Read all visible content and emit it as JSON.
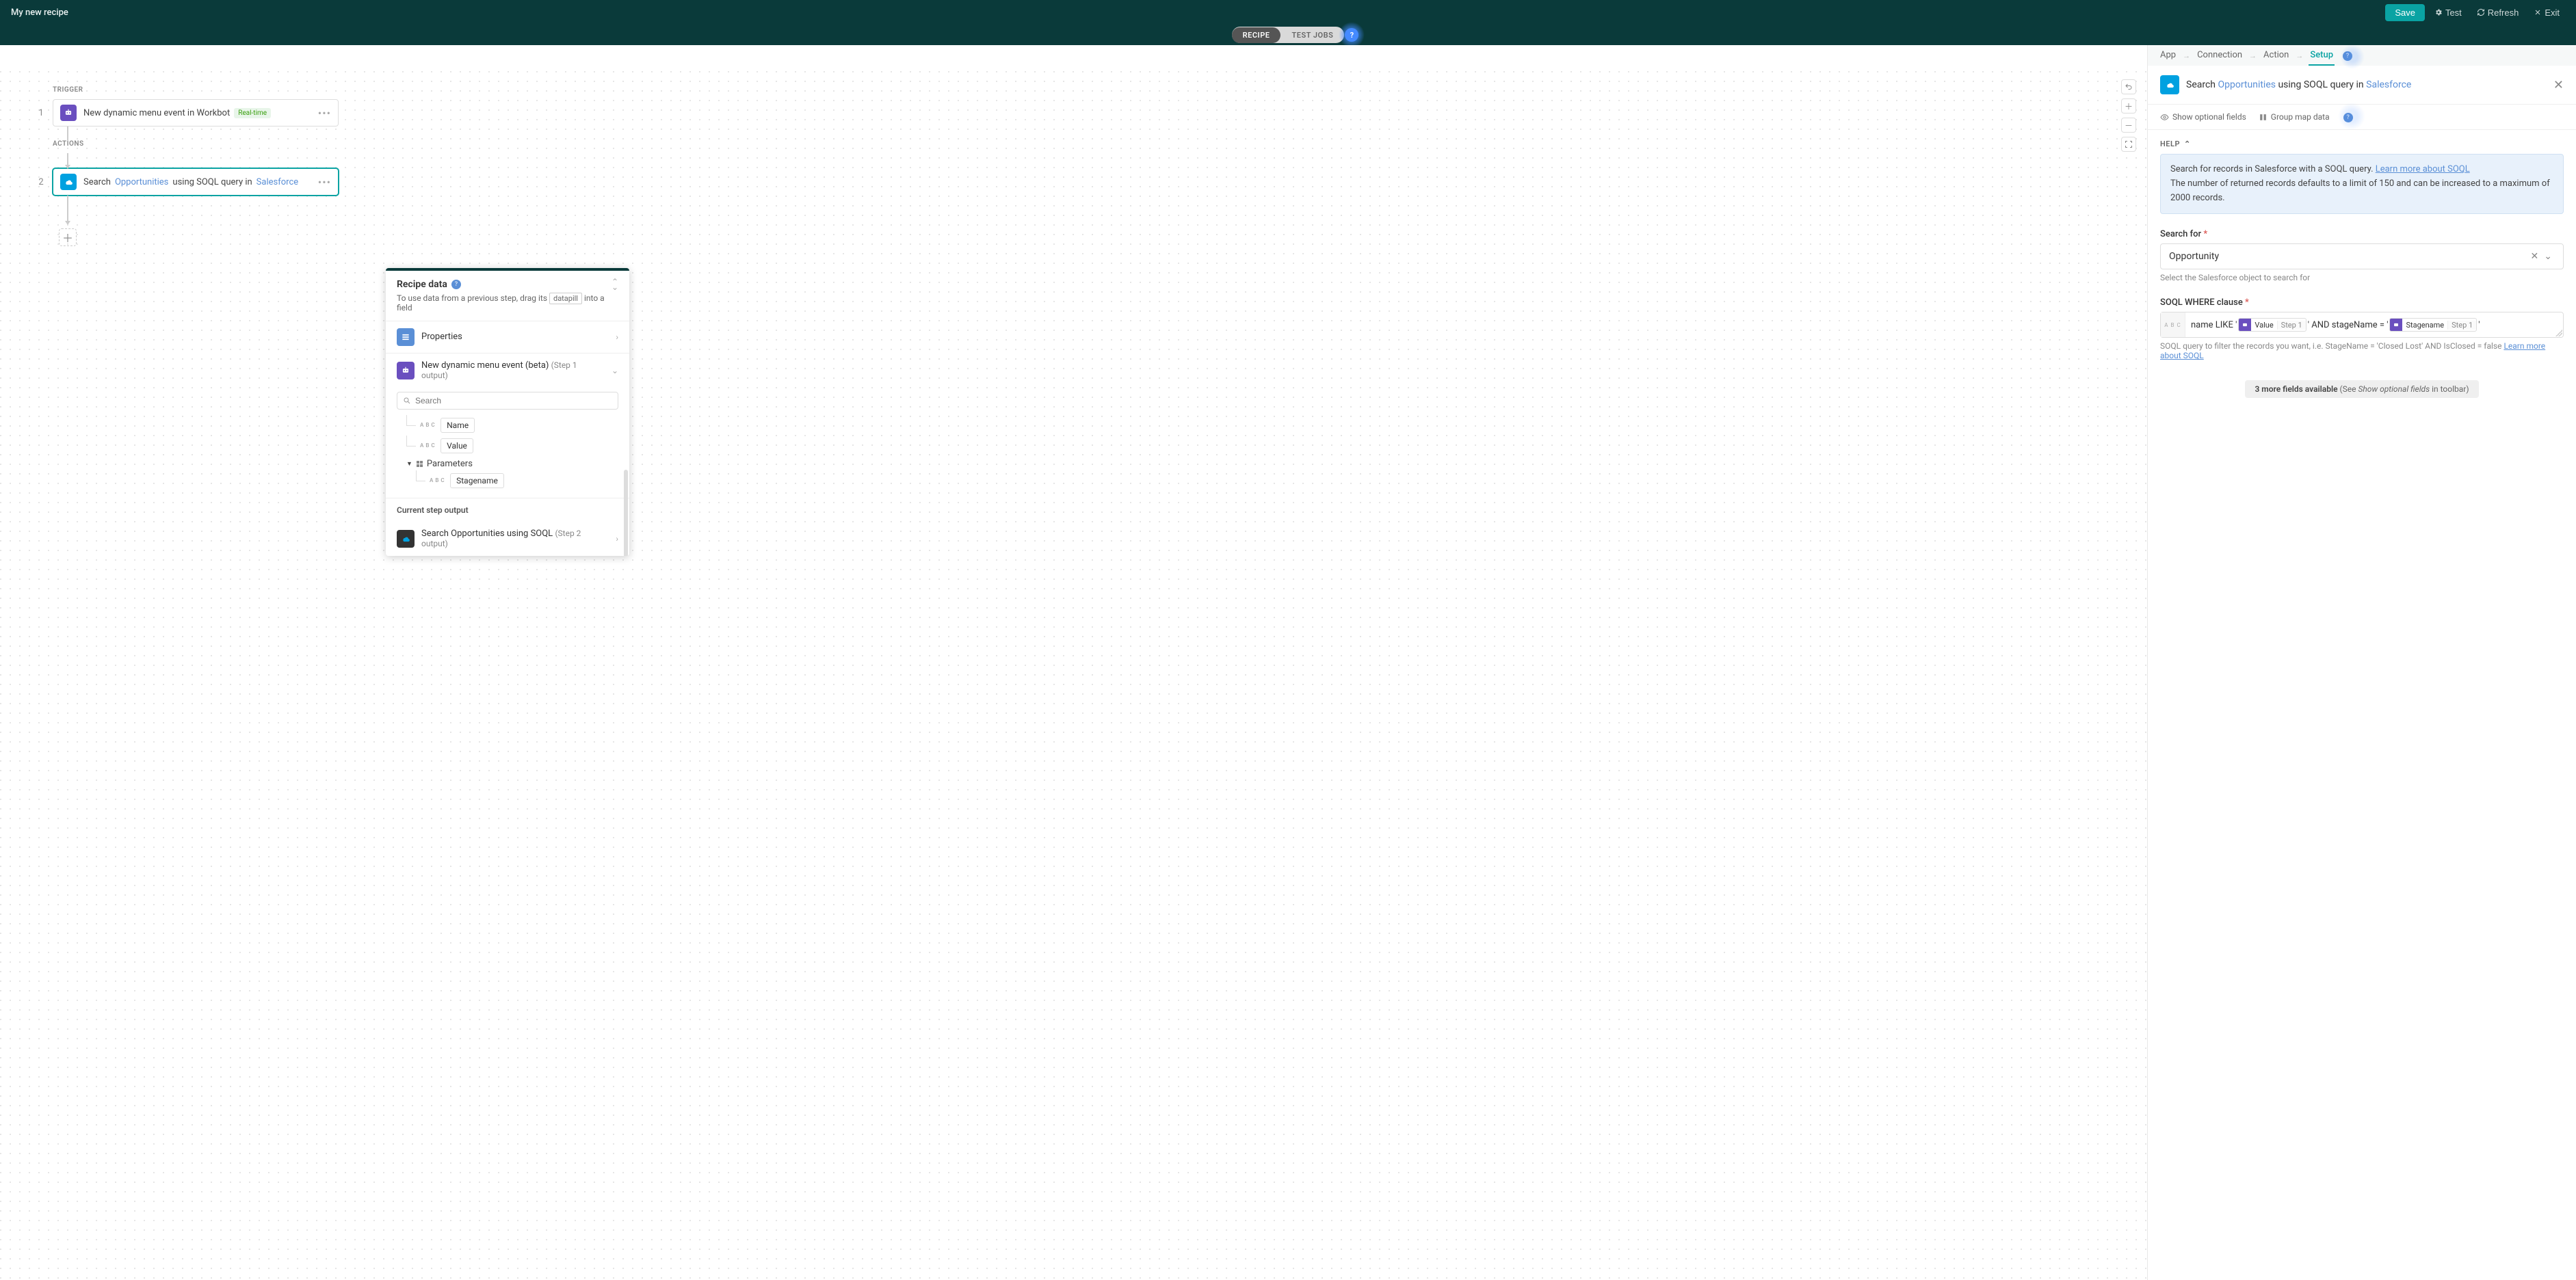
{
  "header": {
    "title": "My new recipe",
    "save": "Save",
    "test": "Test",
    "refresh": "Refresh",
    "exit": "Exit"
  },
  "tabs": {
    "recipe": "RECIPE",
    "test_jobs": "TEST JOBS"
  },
  "canvas": {
    "trigger_label": "TRIGGER",
    "actions_label": "ACTIONS",
    "step1_num": "1",
    "step1_text": "New dynamic menu event in Workbot",
    "step1_badge": "Real-time",
    "step2_num": "2",
    "step2_pre": "Search ",
    "step2_obj": "Opportunities",
    "step2_mid": " using SOQL query in ",
    "step2_app": "Salesforce"
  },
  "datapanel": {
    "title": "Recipe data",
    "sub_pre": "To use data from a previous step, drag its ",
    "sub_pill": "datapill",
    "sub_post": " into a field",
    "properties": "Properties",
    "event_name": "New dynamic menu event (beta)",
    "event_sub": "(Step 1 output)",
    "search_placeholder": "Search",
    "leaf_name": "Name",
    "leaf_value": "Value",
    "params_label": "Parameters",
    "leaf_stagename": "Stagename",
    "current_output": "Current step output",
    "out_name": "Search Opportunities using SOQL",
    "out_sub": "(Step 2 output)",
    "abc": "A B C"
  },
  "rightpanel": {
    "tabs": {
      "app": "App",
      "connection": "Connection",
      "action": "Action",
      "setup": "Setup"
    },
    "head_pre": "Search ",
    "head_obj": "Opportunities",
    "head_mid": " using SOQL query in ",
    "head_app": "Salesforce",
    "tool_show": "Show optional fields",
    "tool_group": "Group map data",
    "help_label": "HELP",
    "help_text1": "Search for records in Salesforce with a SOQL query. ",
    "help_link1": "Learn more about SOQL",
    "help_text2": "The number of returned records defaults to a limit of 150 and can be increased to a maximum of 2000 records.",
    "search_for_label": "Search for",
    "search_for_value": "Opportunity",
    "search_for_hint": "Select the Salesforce object to search for",
    "soql_label": "SOQL WHERE clause",
    "soql_t1": "name LIKE '",
    "pill1_name": "Value",
    "pill1_step": "Step 1",
    "soql_t2": "' AND stageName = '",
    "pill2_name": "Stagename",
    "pill2_step": "Step 1",
    "soql_t3": "'",
    "soql_hint_pre": "SOQL query to filter the records you want, i.e. StageName = 'Closed Lost' AND IsClosed = false ",
    "soql_hint_link": "Learn more about SOQL",
    "more_bold": "3 more fields available",
    "more_pre": " (See ",
    "more_it": "Show optional fields",
    "more_post": " in toolbar)",
    "abc": "A B C"
  }
}
